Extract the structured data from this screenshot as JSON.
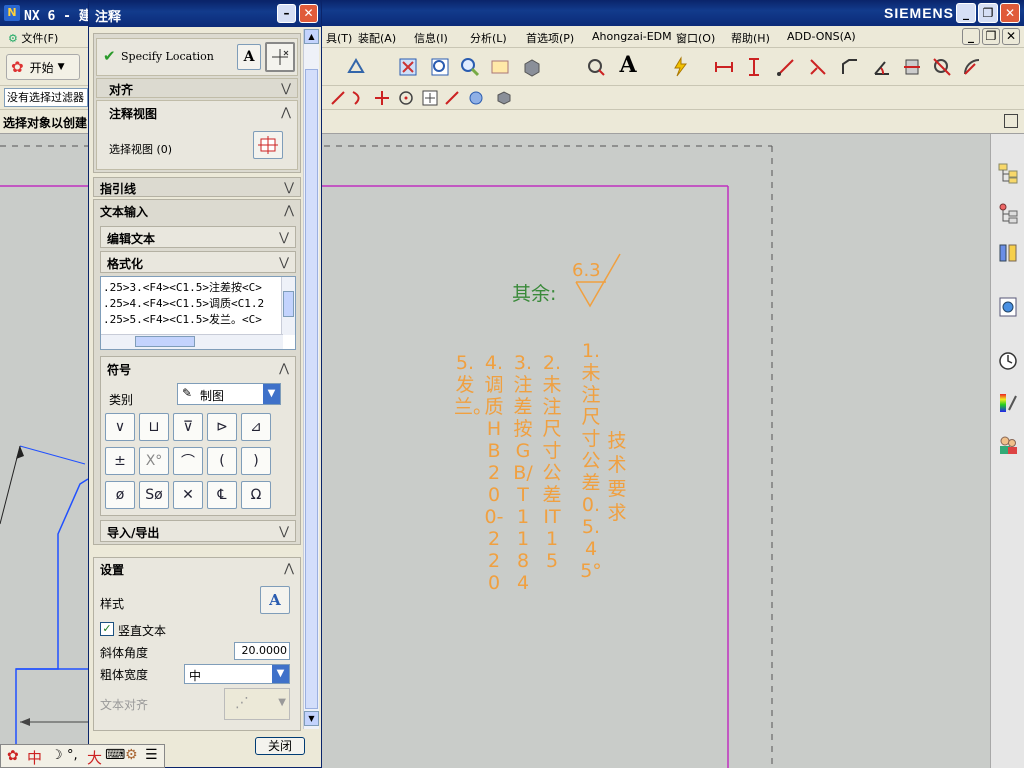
{
  "app": {
    "title": "NX 6 - 建",
    "brand": "SIEMENS",
    "accent": "#0a246a"
  },
  "menubar": {
    "items": [
      "文件(F)",
      "具(T)",
      "装配(A)",
      "信息(I)",
      "分析(L)",
      "首选项(P)",
      "Ahongzai-EDM",
      "窗口(O)",
      "帮助(H)",
      "ADD-ONS(A)"
    ]
  },
  "toolbar": {
    "start_label": "开始",
    "filter_placeholder": "没有选择过滤器",
    "cue_text": "选择对象以创建"
  },
  "dialog": {
    "title": "注释",
    "specify_location": "Specify Location",
    "align_section": "对齐",
    "annotation_view": {
      "header": "注释视图",
      "select_view": "选择视图 (0)"
    },
    "leader_section": "指引线",
    "text_input_section": "文本输入",
    "edit_text_section": "编辑文本",
    "format_section": "格式化",
    "text_lines": [
      ".25>3.<F4><C1.5>注差按<C>",
      ".25>4.<F4><C1.5>调质<C1.2",
      ".25>5.<F4><C1.5>发兰。<C>"
    ],
    "symbols": {
      "header": "符号",
      "category_label": "类别",
      "category_value": "制图",
      "row1": [
        "∨",
        "⊔",
        "⊽",
        "⊳",
        "⊿"
      ],
      "row2": [
        "±",
        "X°",
        "⌒",
        "(",
        ")"
      ],
      "row3": [
        "ø",
        "Sø",
        "✕",
        "℄",
        "Ω"
      ]
    },
    "import_export": "导入/导出",
    "settings": {
      "header": "设置",
      "style_label": "样式",
      "vertical_text_label": "竖直文本",
      "vertical_text_checked": true,
      "slant_label": "斜体角度",
      "slant_value": "20.0000",
      "bold_label": "粗体宽度",
      "bold_value": "中",
      "align_label": "文本对齐"
    },
    "close_button": "关闭"
  },
  "drawing": {
    "rest_label": "其余:",
    "roughness": "6.3",
    "title_cols": [
      "技",
      "术",
      "要",
      "求"
    ],
    "req1": "1.未注尺寸公差0.5.45°",
    "req2": "2.未注尺寸公差IT15",
    "req3": "3.注差按GB/T1184",
    "req4": "4.调质HB200-220",
    "req5": "5.发兰。"
  },
  "ime": {
    "label": "中",
    "items": [
      "☽",
      "°,",
      "大",
      "⌨"
    ]
  }
}
